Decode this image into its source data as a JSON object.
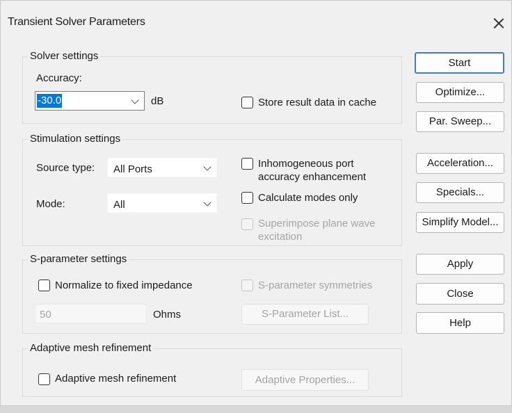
{
  "window": {
    "title": "Transient Solver Parameters"
  },
  "solver": {
    "group_label": "Solver settings",
    "accuracy_label": "Accuracy:",
    "accuracy_value": "-30.0",
    "accuracy_unit": "dB",
    "store_cache_label": "Store result data in cache"
  },
  "stimulation": {
    "group_label": "Stimulation settings",
    "source_type_label": "Source type:",
    "source_type_value": "All Ports",
    "mode_label": "Mode:",
    "mode_value": "All",
    "inhomogeneous_label_1": "Inhomogeneous port",
    "inhomogeneous_label_2": "accuracy enhancement",
    "calc_modes_label": "Calculate modes only",
    "superimpose_label_1": "Superimpose plane wave",
    "superimpose_label_2": "excitation"
  },
  "sparam": {
    "group_label": "S-parameter settings",
    "normalize_label": "Normalize to fixed impedance",
    "symmetries_label": "S-parameter symmetries",
    "impedance_value": "50",
    "impedance_unit": "Ohms",
    "list_button": "S-Parameter List..."
  },
  "adaptive": {
    "group_label": "Adaptive mesh refinement",
    "checkbox_label": "Adaptive mesh refinement",
    "properties_button": "Adaptive Properties..."
  },
  "buttons": {
    "start": "Start",
    "optimize": "Optimize...",
    "par_sweep": "Par. Sweep...",
    "acceleration": "Acceleration...",
    "specials": "Specials...",
    "simplify": "Simplify Model...",
    "apply": "Apply",
    "close": "Close",
    "help": "Help"
  },
  "colors": {
    "accent": "#0078d7",
    "primary_border": "#3c7fc7",
    "disabled_text": "#a4a4a4"
  }
}
